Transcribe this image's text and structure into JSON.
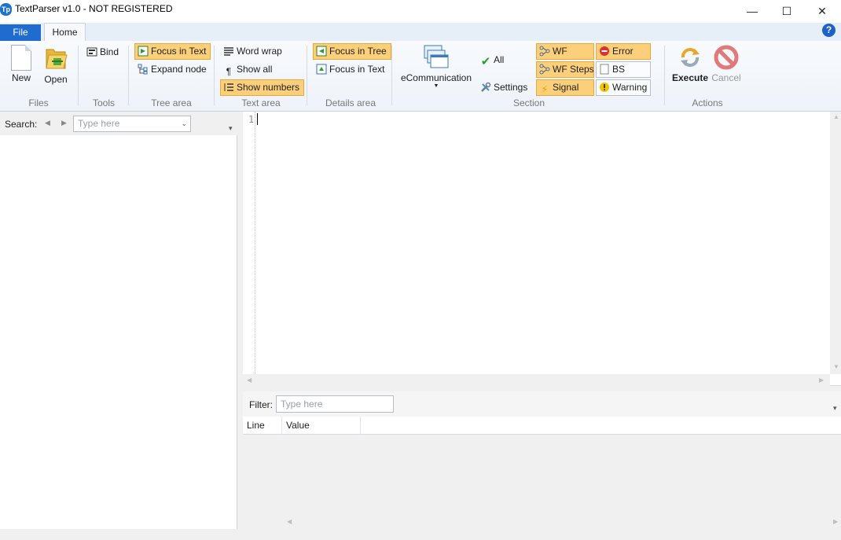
{
  "window": {
    "app_icon_text": "Tp",
    "title": "TextParser v1.0 - NOT REGISTERED",
    "minimize_glyph": "—",
    "maximize_glyph": "☐",
    "close_glyph": "✕"
  },
  "tabs": {
    "file": "File",
    "home": "Home",
    "help_glyph": "?"
  },
  "ribbon": {
    "files": {
      "label": "Files",
      "new": "New",
      "open": "Open"
    },
    "tools": {
      "label": "Tools",
      "bind": "Bind"
    },
    "tree_area": {
      "label": "Tree area",
      "focus_in_text": "Focus in Text",
      "expand_node": "Expand node"
    },
    "text_area": {
      "label": "Text area",
      "word_wrap": "Word wrap",
      "show_all": "Show all",
      "show_numbers": "Show numbers"
    },
    "details_area": {
      "label": "Details area",
      "focus_in_tree": "Focus in Tree",
      "focus_in_text": "Focus in Text"
    },
    "section": {
      "label": "Section",
      "ecommunication": "eCommunication",
      "all": "All",
      "settings": "Settings",
      "wf": "WF",
      "wf_steps": "WF Steps",
      "signal": "Signal",
      "error": "Error",
      "bs": "BS",
      "warning": "Warning"
    },
    "actions": {
      "label": "Actions",
      "execute": "Execute",
      "cancel": "Cancel"
    }
  },
  "left_panel": {
    "search_label": "Search:",
    "search_placeholder": "Type here"
  },
  "editor": {
    "line_numbers": [
      "1"
    ]
  },
  "results": {
    "filter_label": "Filter:",
    "filter_placeholder": "Type here",
    "columns": [
      "Line",
      "Value"
    ]
  },
  "colors": {
    "accent": "#1f6bd0",
    "active_toggle": "#fcd07a",
    "error_red": "#d9332b",
    "warning_yellow": "#f2c200"
  }
}
